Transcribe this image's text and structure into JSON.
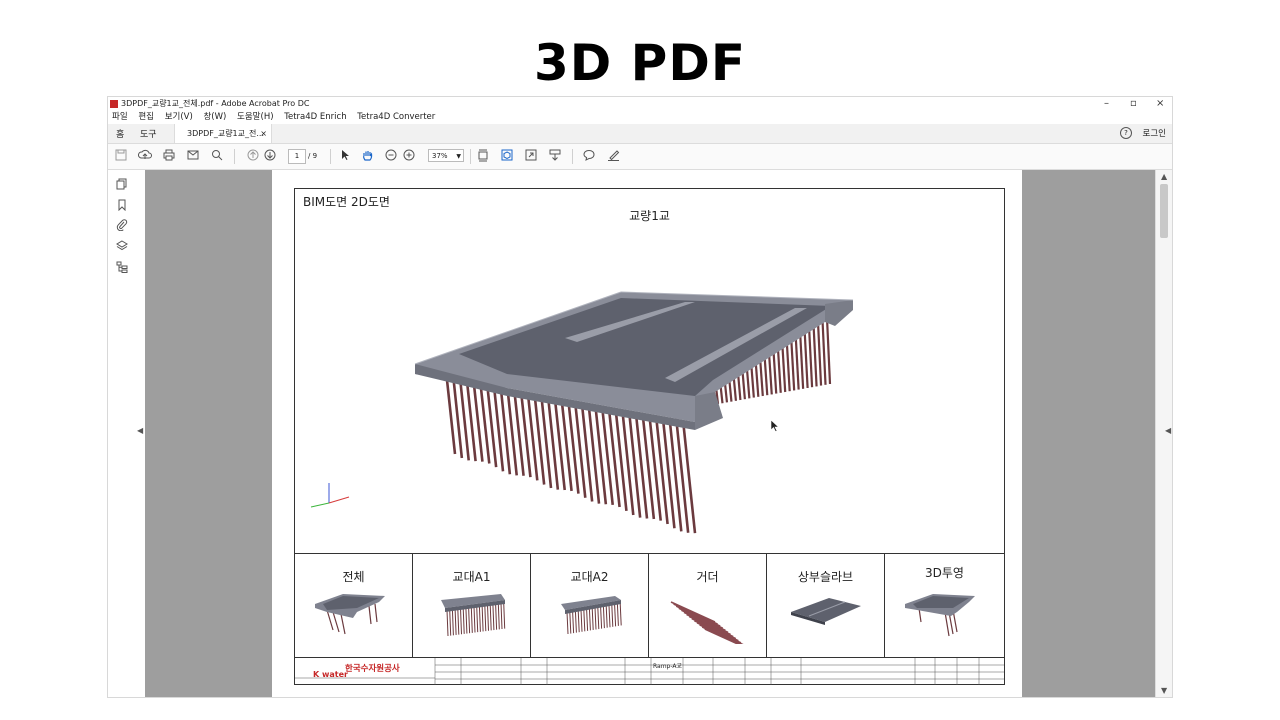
{
  "slide_title": "3D PDF",
  "window": {
    "title": "3DPDF_교량1교_전체.pdf - Adobe Acrobat Pro DC",
    "controls": [
      "–",
      "▫",
      "×"
    ]
  },
  "menu": [
    "파일",
    "편집",
    "보기(V)",
    "창(W)",
    "도움말(H)",
    "Tetra4D Enrich",
    "Tetra4D Converter"
  ],
  "tabs": {
    "home": "홈",
    "tools": "도구",
    "document": "3DPDF_교량1교_전...",
    "close": "×"
  },
  "help_symbol": "?",
  "login": "로그인",
  "toolbar": {
    "page_current": "1",
    "page_total": "/ 9",
    "zoom": "37%"
  },
  "document": {
    "header_left": "BIM도면  2D도면",
    "bridge_title": "교량1교",
    "views": [
      "전체",
      "교대A1",
      "교대A2",
      "거더",
      "상부슬라브",
      "3D투영"
    ],
    "org_korean": "한국수자원공사",
    "org_kwater": "K water",
    "project": "Ramp-A교"
  },
  "colors": {
    "slab": "#6b6e7a",
    "deck_top": "#7f828f",
    "pile": "#6b3a3e",
    "accent_red": "#c62828"
  }
}
